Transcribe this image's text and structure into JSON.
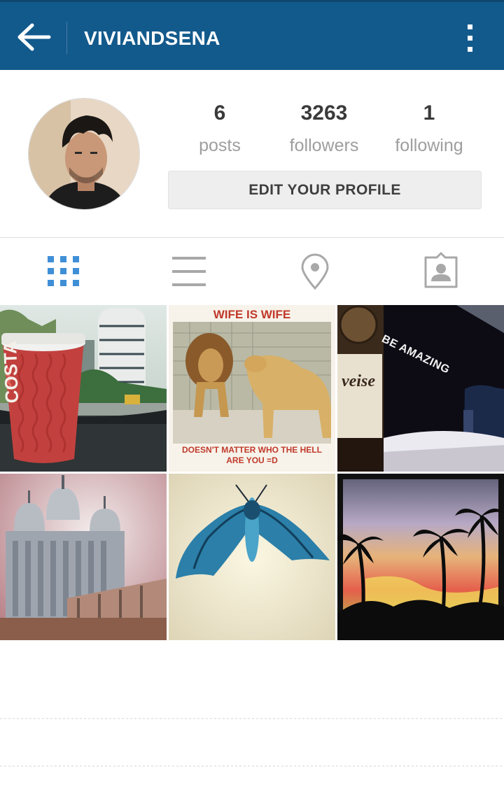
{
  "header": {
    "username": "VIVIANDSENA",
    "back_icon": "back-arrow-icon",
    "menu_icon": "more-vert-icon",
    "background_color": "#135a8c"
  },
  "profile": {
    "stats": {
      "posts": {
        "value": "6",
        "label": "posts"
      },
      "followers": {
        "value": "3263",
        "label": "followers"
      },
      "following": {
        "value": "1",
        "label": "following"
      }
    },
    "edit_button_label": "EDIT YOUR PROFILE"
  },
  "tabs": [
    {
      "name": "grid-view",
      "icon": "grid-icon",
      "active": true,
      "active_color": "#3f8fd7"
    },
    {
      "name": "list-view",
      "icon": "list-icon",
      "active": false
    },
    {
      "name": "photo-map",
      "icon": "location-pin-icon",
      "active": false
    },
    {
      "name": "photos-of-you",
      "icon": "tagged-user-icon",
      "active": false
    }
  ],
  "posts": [
    {
      "subject": "coffee-cup-photo"
    },
    {
      "subject": "lion-meme",
      "caption_top": "WIFE IS WIFE",
      "caption_bottom_1": "DOESN'T MATTER WHO THE HELL",
      "caption_bottom_2": "ARE YOU =D"
    },
    {
      "subject": "beer-bottle-photo",
      "overlay_text": "BE AMAZING"
    },
    {
      "subject": "temple-photo"
    },
    {
      "subject": "moth-photo"
    },
    {
      "subject": "palm-tree-sunset-photo"
    }
  ]
}
